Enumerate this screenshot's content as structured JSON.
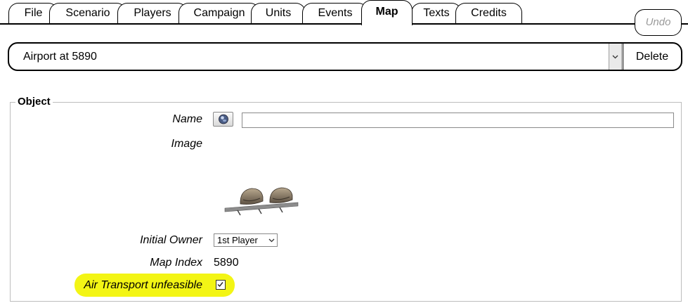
{
  "tabs": [
    {
      "label": "File",
      "active": false
    },
    {
      "label": "Scenario",
      "active": false
    },
    {
      "label": "Players",
      "active": false
    },
    {
      "label": "Campaign",
      "active": false
    },
    {
      "label": "Units",
      "active": false
    },
    {
      "label": "Events",
      "active": false
    },
    {
      "label": "Map",
      "active": true
    },
    {
      "label": "Texts",
      "active": false
    },
    {
      "label": "Credits",
      "active": false
    }
  ],
  "toolbar": {
    "undo_label": "Undo"
  },
  "object_selector": {
    "selected": "Airport at 5890",
    "delete_label": "Delete"
  },
  "object_panel": {
    "legend": "Object",
    "name_label": "Name",
    "name_value": "",
    "image_label": "Image",
    "image_icon": "airport-sprite",
    "owner_label": "Initial Owner",
    "owner_value": "1st Player",
    "map_index_label": "Map Index",
    "map_index_value": "5890",
    "air_transport_label": "Air Transport unfeasible",
    "air_transport_checked": true,
    "highlight_color": "#f3f515"
  }
}
